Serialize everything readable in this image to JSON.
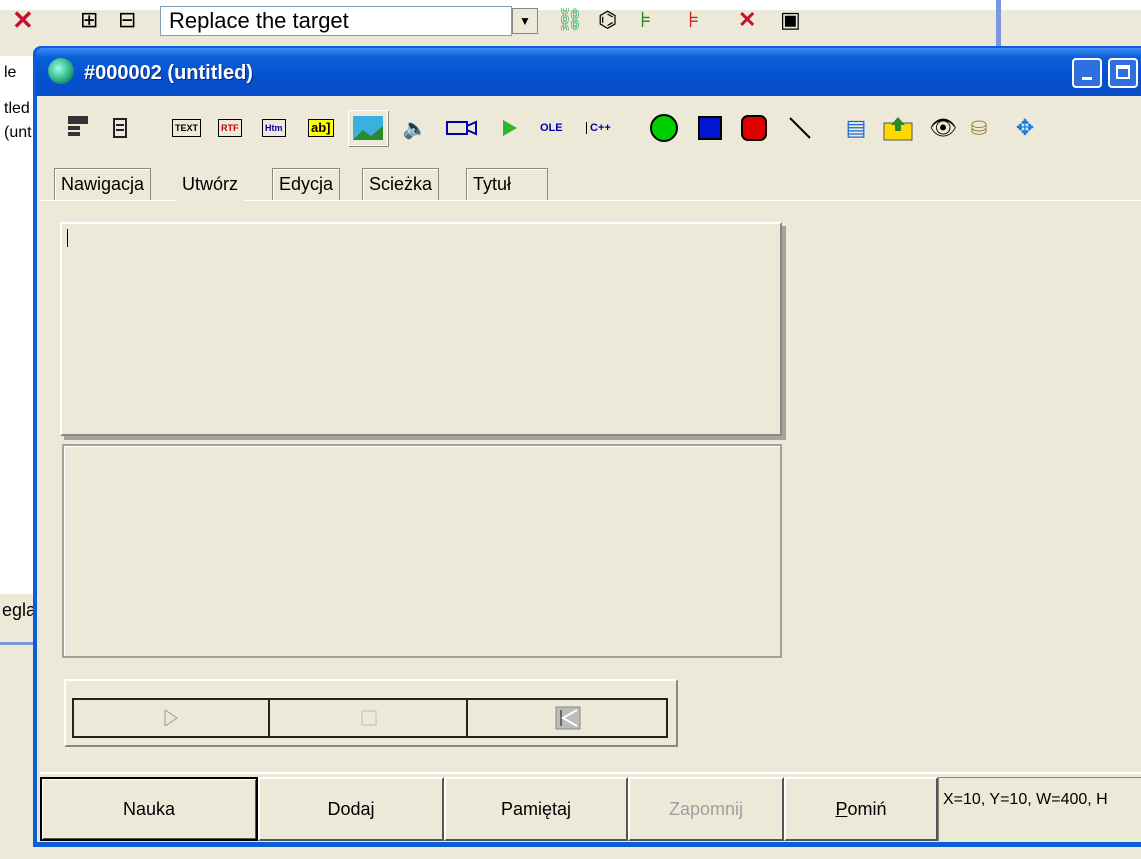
{
  "bg_app": {
    "search_value": "Replace the target",
    "icons": [
      "close-icon",
      "tree-expand-icon",
      "tree-collapse-icon",
      "dropdown-icon",
      "link-icon",
      "binoculars-icon",
      "add-element-icon",
      "remove-element-icon",
      "delete-icon",
      "save-icon"
    ]
  },
  "left_panel": {
    "lines": [
      "le",
      "tled",
      "(unt"
    ],
    "bottom_text": "egla"
  },
  "window": {
    "title": "#000002 (untitled)",
    "title_color": "#0a5fd6"
  },
  "toolbar": {
    "text_label": "TEXT",
    "rtf_label": "RTF",
    "htm_label": "Htm",
    "ab_label": "ab]",
    "ole_label": "OLE",
    "cpp_label": "C++"
  },
  "tabs": [
    "Nawigacja",
    "Utwórz",
    "Edycja",
    "Scieżka",
    "Tytuł"
  ],
  "buttons": {
    "nauka": "Nauka",
    "dodaj": "Dodaj",
    "pamietaj": "Pamiętaj",
    "zapomnij": "Zapomnij",
    "pomin_first": "P",
    "pomin_rest": "omiń"
  },
  "status": "X=10, Y=10, W=400, H"
}
